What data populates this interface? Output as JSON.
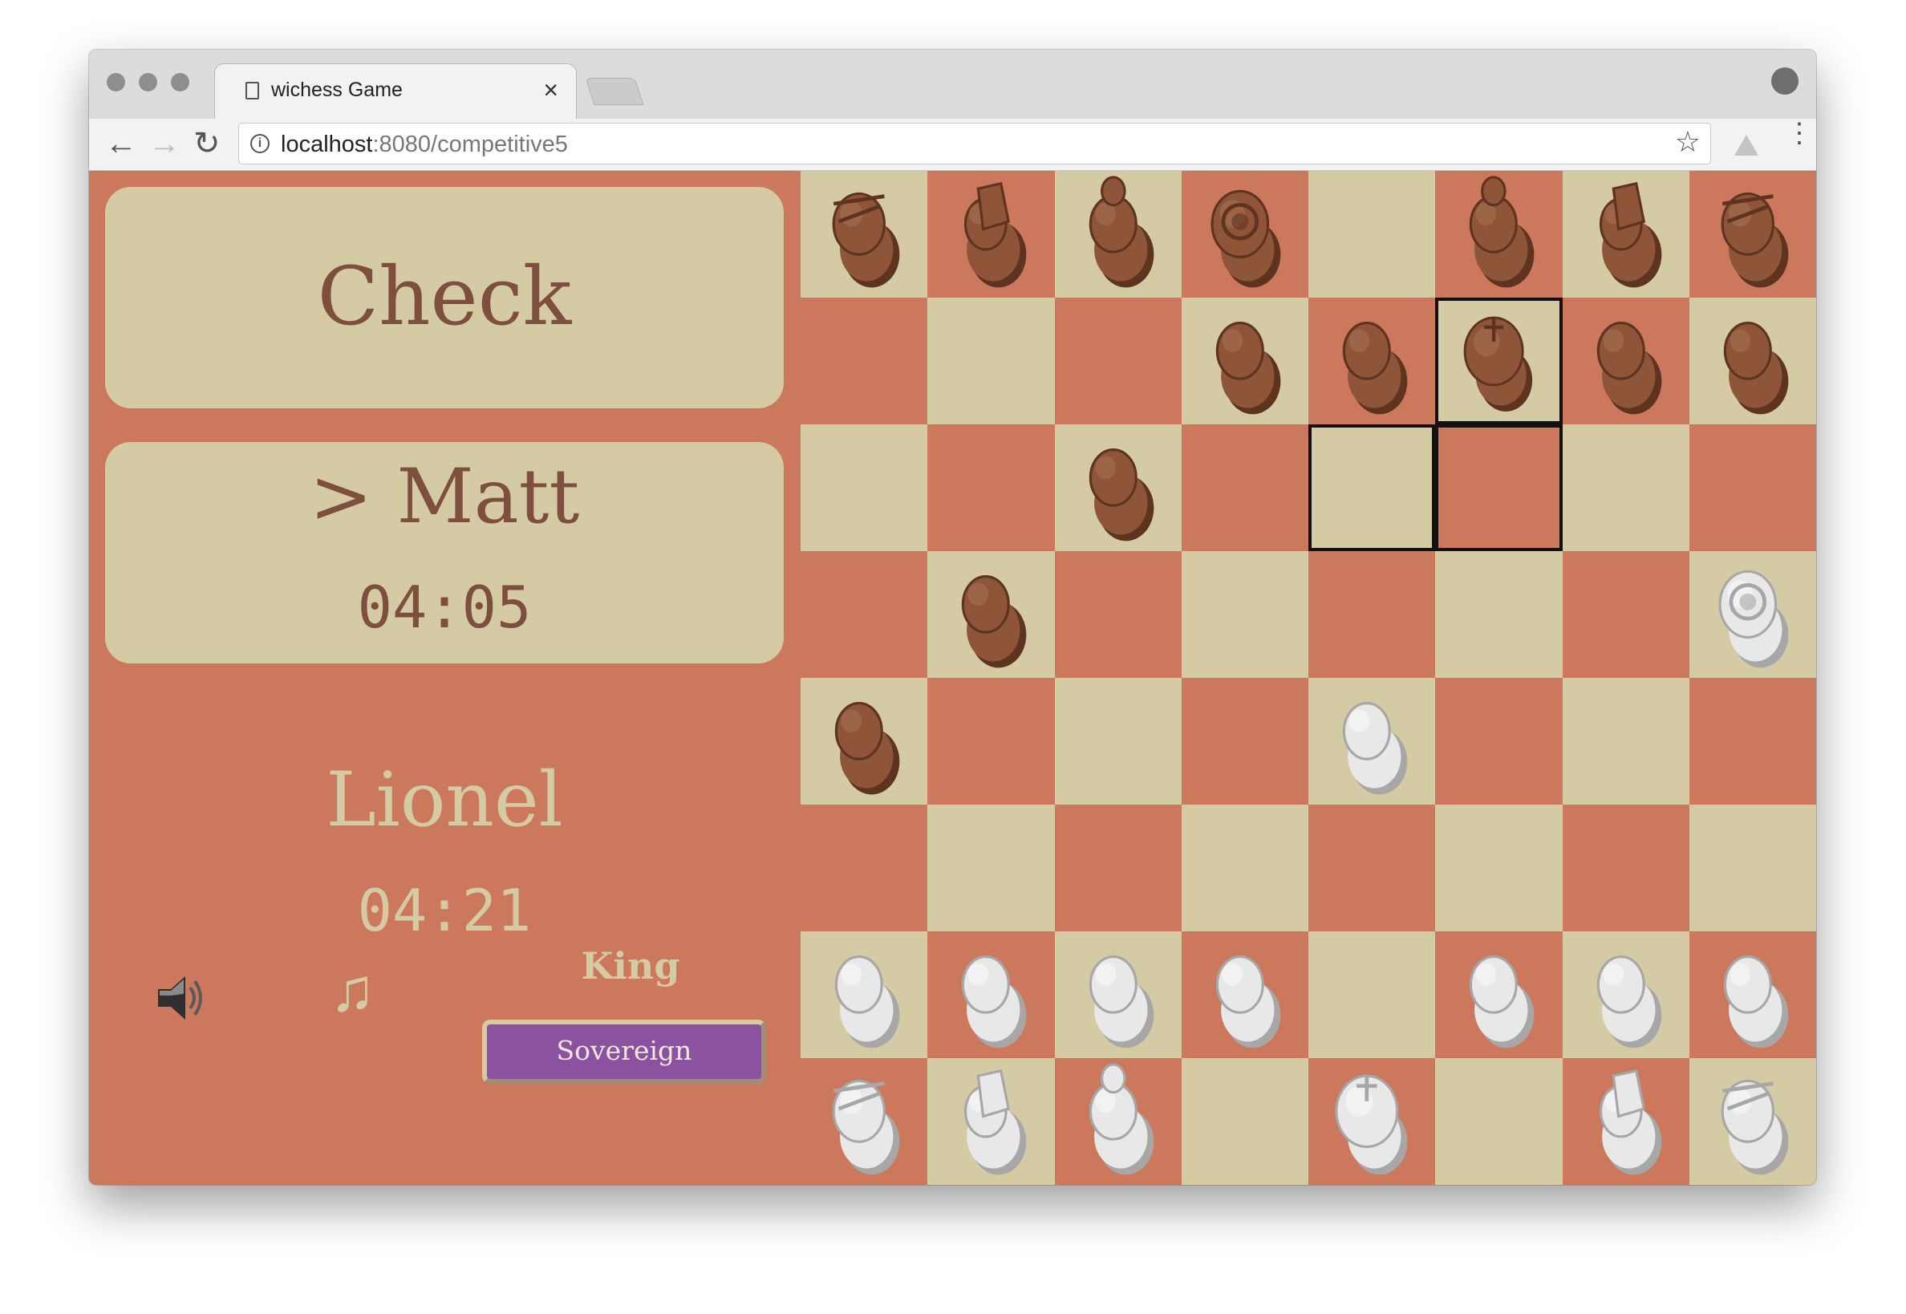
{
  "browser": {
    "tab_title": "wichess Game",
    "tab_close": "×",
    "url_host": "localhost",
    "url_rest": ":8080/competitive5",
    "nav": {
      "back": "←",
      "forward": "→",
      "reload": "↻"
    },
    "star": "☆",
    "menu": "⋮",
    "info": "i"
  },
  "game": {
    "status": "Check",
    "active_player": {
      "name": "> Matt",
      "clock": "04:05"
    },
    "idle_player": {
      "name": "Lionel",
      "clock": "04:21"
    },
    "sound_icon": "speaker-icon",
    "music_icon": "♫",
    "role_label": "King",
    "role_button": "Sovereign"
  },
  "colors": {
    "light_square": "#d4cba5",
    "dark_square": "#cc785c",
    "text_dark": "#7e4f3e",
    "button_purple": "#8a52a1",
    "brown_piece": "#8e5538",
    "white_piece": "#e8e8e8"
  },
  "board": {
    "first_square_light": true,
    "highlighted": [
      "f7",
      "e6",
      "f6"
    ],
    "pieces": [
      {
        "square": "a8",
        "color": "black",
        "piece": "rook"
      },
      {
        "square": "b8",
        "color": "black",
        "piece": "knight"
      },
      {
        "square": "c8",
        "color": "black",
        "piece": "bishop"
      },
      {
        "square": "d8",
        "color": "black",
        "piece": "queen"
      },
      {
        "square": "f8",
        "color": "black",
        "piece": "bishop"
      },
      {
        "square": "g8",
        "color": "black",
        "piece": "knight"
      },
      {
        "square": "h8",
        "color": "black",
        "piece": "rook"
      },
      {
        "square": "d7",
        "color": "black",
        "piece": "pawn"
      },
      {
        "square": "e7",
        "color": "black",
        "piece": "pawn"
      },
      {
        "square": "f7",
        "color": "black",
        "piece": "king"
      },
      {
        "square": "g7",
        "color": "black",
        "piece": "pawn"
      },
      {
        "square": "h7",
        "color": "black",
        "piece": "pawn"
      },
      {
        "square": "c6",
        "color": "black",
        "piece": "pawn"
      },
      {
        "square": "b5",
        "color": "black",
        "piece": "pawn"
      },
      {
        "square": "h5",
        "color": "white",
        "piece": "queen"
      },
      {
        "square": "a4",
        "color": "black",
        "piece": "pawn"
      },
      {
        "square": "e4",
        "color": "white",
        "piece": "pawn"
      },
      {
        "square": "a2",
        "color": "white",
        "piece": "pawn"
      },
      {
        "square": "b2",
        "color": "white",
        "piece": "pawn"
      },
      {
        "square": "c2",
        "color": "white",
        "piece": "pawn"
      },
      {
        "square": "d2",
        "color": "white",
        "piece": "pawn"
      },
      {
        "square": "f2",
        "color": "white",
        "piece": "pawn"
      },
      {
        "square": "g2",
        "color": "white",
        "piece": "pawn"
      },
      {
        "square": "h2",
        "color": "white",
        "piece": "pawn"
      },
      {
        "square": "a1",
        "color": "white",
        "piece": "rook"
      },
      {
        "square": "b1",
        "color": "white",
        "piece": "knight"
      },
      {
        "square": "c1",
        "color": "white",
        "piece": "bishop"
      },
      {
        "square": "e1",
        "color": "white",
        "piece": "king"
      },
      {
        "square": "g1",
        "color": "white",
        "piece": "knight"
      },
      {
        "square": "h1",
        "color": "white",
        "piece": "rook"
      }
    ]
  }
}
